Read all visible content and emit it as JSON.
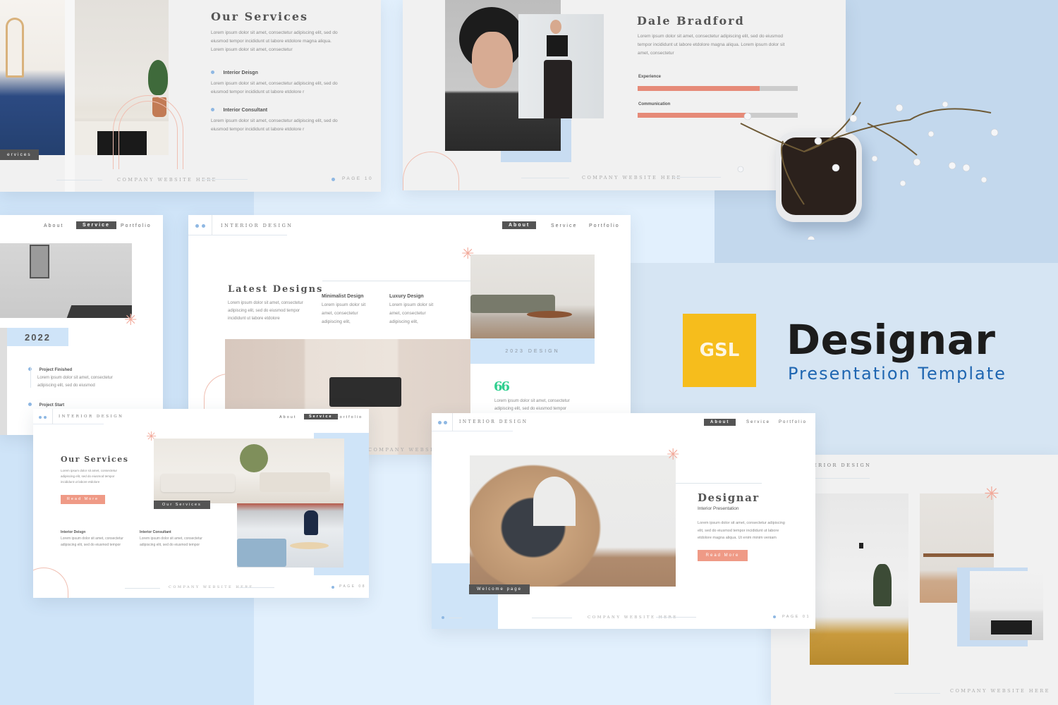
{
  "brand": {
    "logo_text": "GSL",
    "logo_color": "#f6bd1c",
    "title": "Designar",
    "subtitle": "Presentation Template",
    "subtitle_color": "#1f66b1"
  },
  "colors": {
    "accent_salmon": "#ef9a86",
    "accent_blue": "#8fb8e3",
    "panel_blue": "#cfe4f8",
    "dark_tag": "#545454"
  },
  "nav": {
    "about": "About",
    "service": "Service",
    "portfolio": "Portfolio"
  },
  "common": {
    "section_label": "INTERIOR DESIGN",
    "company_website": "COMPANY WEBSITE HERE"
  },
  "slide_services_top": {
    "title": "Our Services",
    "intro": "Lorem ipsum dolor sit amet, consectetur adipiscing elit, sed do eiusmod tempor incididunt ut labore etdolore magna aliqua. Lorem ipsum dolor sit amet, consectetur",
    "items": [
      {
        "title": "Interior Deisgn",
        "text": "Lorem ipsum dolor sit amet, consectetur adipiscing elit, sed do eiusmod tempor incididunt ut labore etdolore r"
      },
      {
        "title": "Interior Consultant",
        "text": "Lorem ipsum dolor sit amet, consectetur adipiscing elit, sed do eiusmod tempor incididunt ut labore etdolore r"
      }
    ],
    "tag": "ervices",
    "page": "PAGE 10"
  },
  "slide_profile": {
    "name": "Dale Bradford",
    "bio": "Lorem ipsum dolor sit amet, consectetur adipiscing elit, sed do eiusmod tempor incididunt ut labore etdolore magna aliqua. Lorem ipsum dolor sit amet, consectetur",
    "skills": [
      {
        "label": "Experience",
        "percent": 76
      },
      {
        "label": "Communication",
        "percent": 70
      }
    ]
  },
  "slide_timeline": {
    "year": "2022",
    "events": [
      {
        "title": "Project Finished",
        "text": "Lorem ipsum dolor sit amet, consectetur adipiscing elit, sed do eiusmod"
      },
      {
        "title": "Project Start",
        "text": ""
      }
    ]
  },
  "slide_latest": {
    "title": "Latest Designs",
    "intro": "Lorem ipsum dolor sit amet, consectetur adipiscing elit, sed do eiusmod tempor incididunt ut labore etdolore",
    "columns": [
      {
        "title": "Minimalist Design",
        "text": "Lorem ipsum dolor sit amet, consectetur adipiscing elit,"
      },
      {
        "title": "Luxury Design",
        "text": "Lorem ipsum dolor sit amet, consectetur adipiscing elit,"
      }
    ],
    "caption": "2023 DESIGN",
    "quote_mark": "66",
    "quote": "Lorem ipsum dolor sit amet, consectetur adipiscing elit, sed do eiusmod tempor"
  },
  "slide_services_bottom": {
    "title": "Our Services",
    "intro": "Lorem ipsum dolor sit amet, consectetur adipiscing elit, sed do eiusmod tempor incididunt ut labore etdolore",
    "button": "Read More",
    "tag": "Our Services",
    "items": [
      {
        "title": "Interior Deisgn",
        "text": "Lorem ipsum dolor sit amet, consectetur adipiscing elit, sed do eiusmod tempor"
      },
      {
        "title": "Interior Consultant",
        "text": "Lorem ipsum dolor sit amet, consectetur adipiscing elit, sed do eiusmod tempor"
      }
    ],
    "page": "PAGE 08"
  },
  "slide_welcome": {
    "title": "Designar",
    "subtitle": "Interior Presentation",
    "text": "Lorem ipsum dolor sit amet, consectetur adipiscing elit, sed do eiusmod tempor incididunt ut labore etdolore magna aliqua. Ut enim minim veniam",
    "button": "Read More",
    "tag": "Welcome page",
    "page": "PAGE 01"
  },
  "slide_gallery": {
    "section_label": "ERIOR DESIGN"
  }
}
